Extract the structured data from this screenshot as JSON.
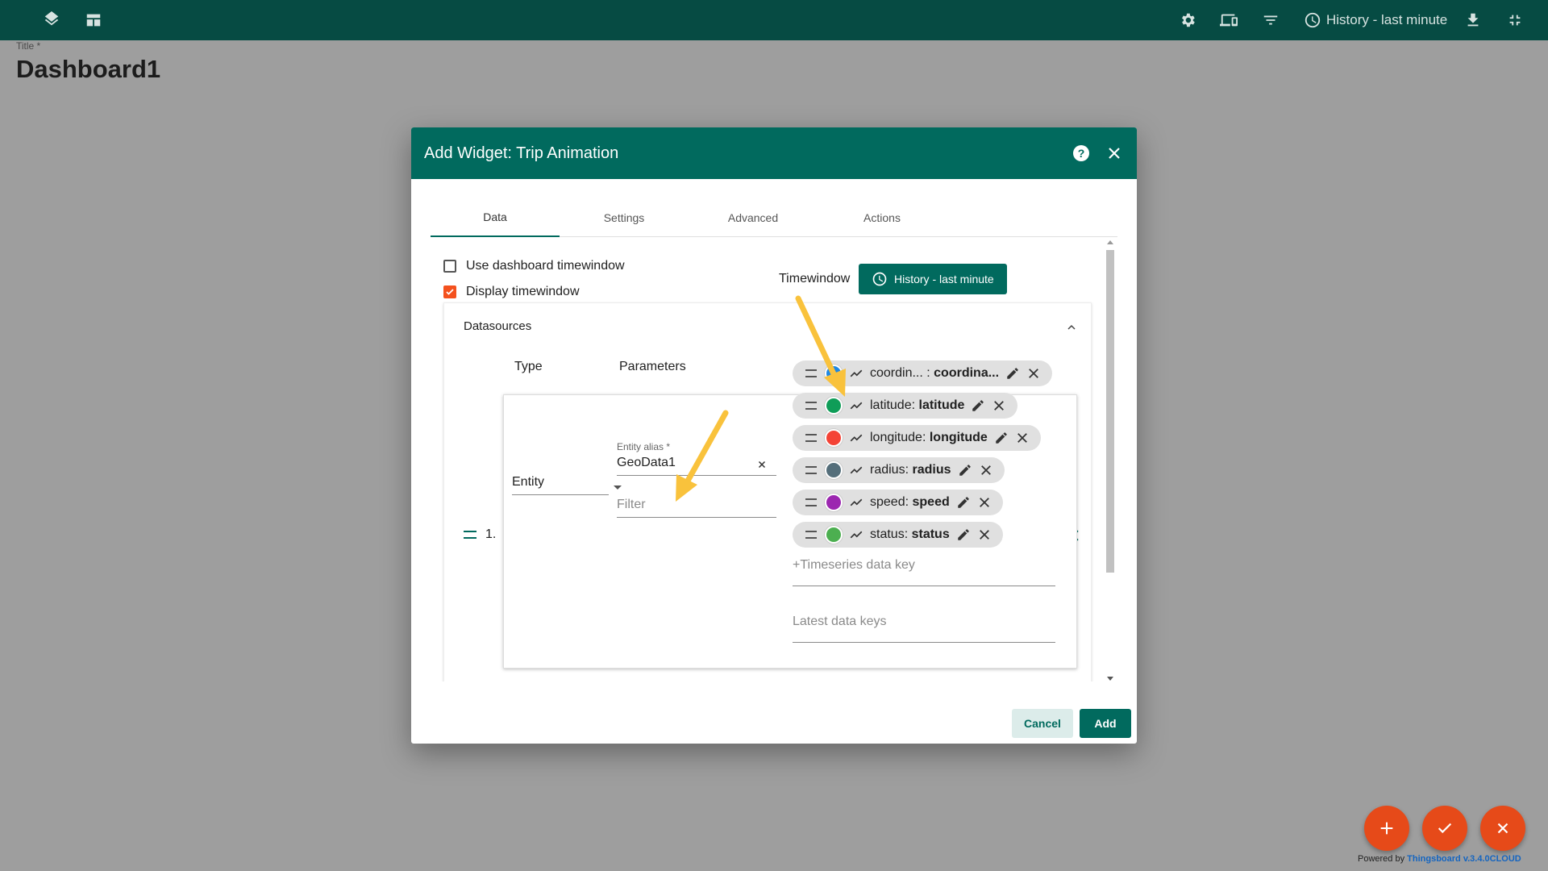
{
  "topbar": {
    "icons": [
      "layers-icon",
      "dashboard-layout-icon",
      "settings-icon",
      "devices-icon",
      "filter-icon",
      "clock-icon",
      "download-icon",
      "fullscreen-exit-icon"
    ],
    "history_label": "History - last minute"
  },
  "dashboard": {
    "title_label": "Title *",
    "title": "Dashboard1"
  },
  "dialog": {
    "title": "Add Widget: Trip Animation",
    "tabs": [
      {
        "label": "Data"
      },
      {
        "label": "Settings"
      },
      {
        "label": "Advanced"
      },
      {
        "label": "Actions"
      }
    ],
    "use_dashboard_timewindow": "Use dashboard timewindow",
    "display_timewindow": "Display timewindow",
    "timewindow_label": "Timewindow",
    "timewindow_button": "History - last minute",
    "datasources_title": "Datasources",
    "col_type": "Type",
    "col_parameters": "Parameters",
    "row_index": "1.",
    "type_value": "Entity",
    "entity_alias_label": "Entity alias *",
    "entity_alias_value": "GeoData1",
    "filter_placeholder": "Filter",
    "timeseries_placeholder": "+Timeseries data key",
    "latest_placeholder": "Latest data keys",
    "cancel_label": "Cancel",
    "add_label": "Add"
  },
  "chips": [
    {
      "key": "coordin... :",
      "label": "coordina...",
      "color": "#1e88e5"
    },
    {
      "key": "latitude:",
      "label": "latitude",
      "color": "#0f9d58"
    },
    {
      "key": "longitude:",
      "label": "longitude",
      "color": "#f44336"
    },
    {
      "key": "radius:",
      "label": "radius",
      "color": "#546e7a"
    },
    {
      "key": "speed:",
      "label": "speed",
      "color": "#9c27b0"
    },
    {
      "key": "status:",
      "label": "status",
      "color": "#4caf50"
    }
  ],
  "colors": {
    "header": "#064b43",
    "accent": "#016a5e",
    "fab": "#e64a19",
    "checkbox_on": "#f4511e",
    "arrow": "#f9c23c"
  },
  "footer": {
    "powered_prefix": "Powered by",
    "powered_brand": "Thingsboard v.3.4.0CLOUD"
  }
}
